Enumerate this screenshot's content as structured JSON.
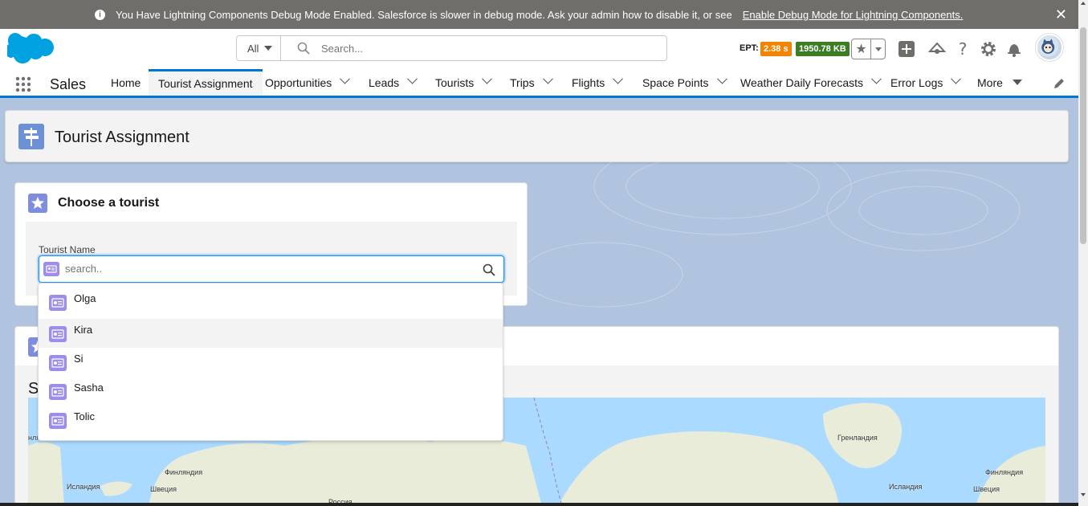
{
  "debug_banner": {
    "message": "You Have Lightning Components Debug Mode Enabled. Salesforce is slower in debug mode. Ask your admin how to disable it, or see",
    "link": "Enable Debug Mode for Lightning Components.",
    "close": "✕"
  },
  "global_header": {
    "search_scope": "All",
    "search_placeholder": "Search...",
    "ept_label": "EPT:",
    "ept_time": "2.38 s",
    "ept_memory": "1950.78 KB"
  },
  "nav": {
    "app_name": "Sales",
    "items": [
      {
        "label": "Home"
      },
      {
        "label": "Tourist Assignment"
      },
      {
        "label": "Opportunities"
      },
      {
        "label": "Leads"
      },
      {
        "label": "Tourists"
      },
      {
        "label": "Trips"
      },
      {
        "label": "Flights"
      },
      {
        "label": "Space Points"
      },
      {
        "label": "Weather Daily Forecasts"
      },
      {
        "label": "Error Logs"
      },
      {
        "label": "More"
      }
    ]
  },
  "page_header": {
    "title": "Tourist Assignment"
  },
  "choose_card": {
    "title": "Choose a tourist",
    "field_label": "Tourist Name",
    "search_placeholder": "search.."
  },
  "dropdown": {
    "results": [
      {
        "label": "Olga"
      },
      {
        "label": "Kira"
      },
      {
        "label": "Si"
      },
      {
        "label": "Sasha"
      },
      {
        "label": "Tolic"
      }
    ]
  },
  "second_card": {
    "title_partial": "S"
  },
  "map": {
    "labels": [
      "нля",
      "Финляндия",
      "Исландия",
      "Швеция",
      "Гренландия",
      "Исландия",
      "Финляндия",
      "Швеция",
      "Россия"
    ]
  },
  "colors": {
    "brand_blue": "#0176d3",
    "banner_gray": "#706e6b",
    "ept_orange": "#f38303",
    "ept_green": "#3b7d23",
    "contact_icon_purple": "#9e8ee9"
  }
}
